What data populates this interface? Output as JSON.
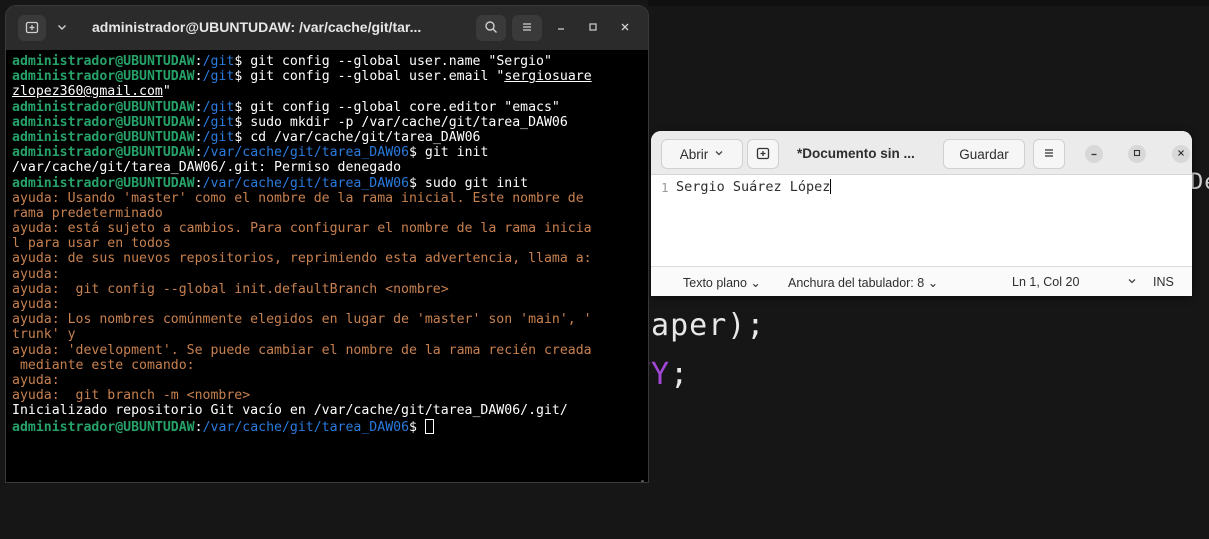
{
  "background": {
    "line1": "paper);",
    "line2_keyword": "TY",
    "line2_punct": ";",
    "edge_text": "De"
  },
  "terminal": {
    "title": "administrador@UBUNTUDAW: /var/cache/git/tar...",
    "user": "administrador@UBUNTUDAW",
    "lines": [
      {
        "path": "/git",
        "cmd": "git config --global user.name \"Sergio\""
      },
      {
        "path": "/git",
        "cmd": "git config --global user.email \"",
        "cmd_ul": "sergiosuare"
      },
      {
        "out_ul": "zlopez360@gmail.com",
        "out_tail": "\""
      },
      {
        "path": "/git",
        "cmd": "git config --global core.editor \"emacs\""
      },
      {
        "path": "/git",
        "cmd": "sudo mkdir -p /var/cache/git/tarea_DAW06"
      },
      {
        "path": "/git",
        "cmd": "cd /var/cache/git/tarea_DAW06"
      },
      {
        "path": "/var/cache/git/tarea_DAW06",
        "cmd": "git init"
      },
      {
        "out": "/var/cache/git/tarea_DAW06/.git: Permiso denegado"
      },
      {
        "path": "/var/cache/git/tarea_DAW06",
        "cmd": "sudo git init"
      },
      {
        "hint": "ayuda: Usando 'master' como el nombre de la rama inicial. Este nombre de"
      },
      {
        "hint": "rama predeterminado"
      },
      {
        "hint": "ayuda: está sujeto a cambios. Para configurar el nombre de la rama inicia"
      },
      {
        "hint": "l para usar en todos"
      },
      {
        "hint": "ayuda: de sus nuevos repositorios, reprimiendo esta advertencia, llama a:"
      },
      {
        "hint": "ayuda:"
      },
      {
        "hint": "ayuda:  git config --global init.defaultBranch <nombre>"
      },
      {
        "hint": "ayuda:"
      },
      {
        "hint": "ayuda: Los nombres comúnmente elegidos en lugar de 'master' son 'main', '"
      },
      {
        "hint": "trunk' y"
      },
      {
        "hint": "ayuda: 'development'. Se puede cambiar el nombre de la rama recién creada"
      },
      {
        "hint": " mediante este comando:"
      },
      {
        "hint": "ayuda:"
      },
      {
        "hint": "ayuda:  git branch -m <nombre>"
      },
      {
        "out": "Inicializado repositorio Git vacío en /var/cache/git/tarea_DAW06/.git/"
      },
      {
        "path": "/var/cache/git/tarea_DAW06",
        "cmd": "",
        "cursor": true
      }
    ]
  },
  "editor": {
    "open_label": "Abrir",
    "title": "*Documento sin ...",
    "save_label": "Guardar",
    "line_number": "1",
    "content": "Sergio Suárez López",
    "status": {
      "mode": "Texto plano",
      "tab_width": "Anchura del tabulador: 8",
      "position": "Ln 1, Col 20",
      "insert_mode": "INS"
    }
  }
}
